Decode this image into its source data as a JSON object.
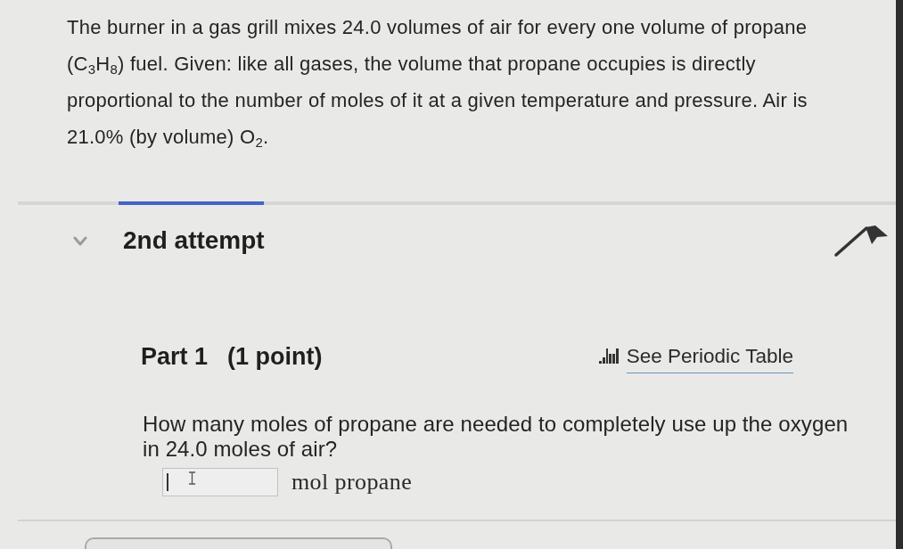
{
  "problem": {
    "text": "The burner in a gas grill mixes 24.0 volumes of air for every one volume of propane (C$_{3}$H$_{8}$) fuel. Given: like all gases, the volume that propane occupies is directly proportional to the number of moles of it at a given temperature and pressure. Air is 21.0% (by volume) O$_{2}$."
  },
  "attempt": {
    "label": "2nd attempt",
    "expanded": true
  },
  "part": {
    "title": "Part 1",
    "points": "(1 point)",
    "periodic_table_link": "See Periodic Table"
  },
  "question": {
    "text": "How many moles of propane are needed to completely use up the oxygen in 24.0 moles of air?",
    "answer": {
      "focused": true,
      "unit": "mol propane"
    }
  }
}
